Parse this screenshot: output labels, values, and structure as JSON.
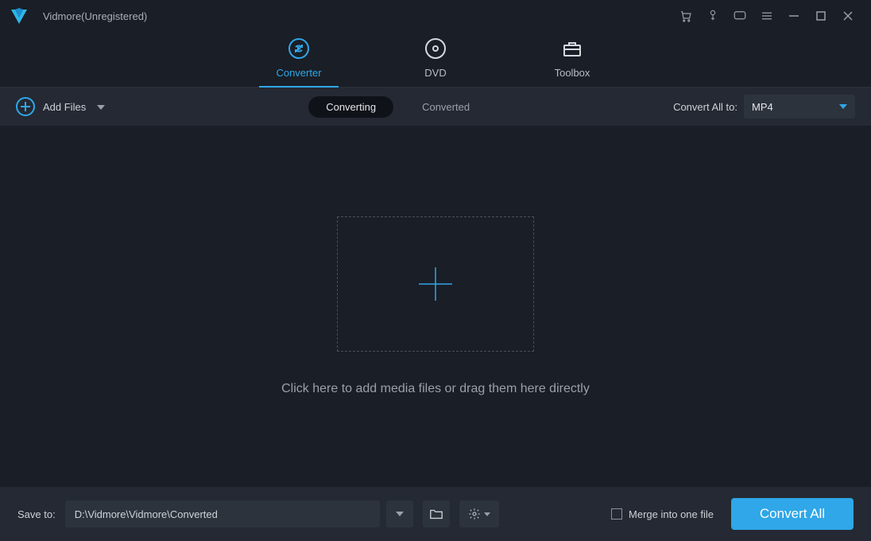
{
  "title": "Vidmore(Unregistered)",
  "nav": {
    "converter": "Converter",
    "dvd": "DVD",
    "toolbox": "Toolbox"
  },
  "subbar": {
    "add_files": "Add Files",
    "converting": "Converting",
    "converted": "Converted",
    "convert_all_to_label": "Convert All to:",
    "format": "MP4"
  },
  "main": {
    "hint": "Click here to add media files or drag them here directly"
  },
  "footer": {
    "save_to_label": "Save to:",
    "path": "D:\\Vidmore\\Vidmore\\Converted",
    "merge_label": "Merge into one file",
    "convert_all": "Convert All"
  }
}
